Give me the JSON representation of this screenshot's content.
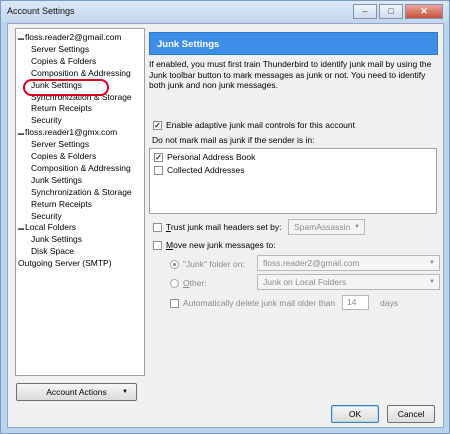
{
  "window": {
    "title": "Account Settings"
  },
  "tree": {
    "items": [
      {
        "label": "floss.reader2@gmail.com",
        "level": 0,
        "expander": "▬"
      },
      {
        "label": "Server Settings",
        "level": 1
      },
      {
        "label": "Copies & Folders",
        "level": 1
      },
      {
        "label": "Composition & Addressing",
        "level": 1
      },
      {
        "label": "Junk Settings",
        "level": 1
      },
      {
        "label": "Synchronization & Storage",
        "level": 1
      },
      {
        "label": "Return Receipts",
        "level": 1
      },
      {
        "label": "Security",
        "level": 1
      },
      {
        "label": "floss.reader1@gmx.com",
        "level": 0,
        "expander": "▬"
      },
      {
        "label": "Server Settings",
        "level": 1
      },
      {
        "label": "Copies & Folders",
        "level": 1
      },
      {
        "label": "Composition & Addressing",
        "level": 1
      },
      {
        "label": "Junk Settings",
        "level": 1
      },
      {
        "label": "Synchronization & Storage",
        "level": 1
      },
      {
        "label": "Return Receipts",
        "level": 1
      },
      {
        "label": "Security",
        "level": 1
      },
      {
        "label": "Local Folders",
        "level": 0,
        "expander": "▬"
      },
      {
        "label": "Junk Settings",
        "level": 1
      },
      {
        "label": "Disk Space",
        "level": 1
      },
      {
        "label": "Outgoing Server (SMTP)",
        "level": 0
      }
    ]
  },
  "account_actions": {
    "label": "Account Actions",
    "arrow": "▼"
  },
  "panel": {
    "header": "Junk Settings",
    "intro": "If enabled, you must first train Thunderbird to identify junk mail by using the Junk toolbar button to mark messages as junk or not. You need to identify both junk and non junk messages.",
    "enable_adaptive": {
      "label": "Enable adaptive junk mail controls for this account",
      "checked": true
    },
    "whitelist_label": "Do not mark mail as junk if the sender is in:",
    "address_books": [
      {
        "label": "Personal Address Book",
        "checked": true
      },
      {
        "label": "Collected Addresses",
        "checked": false
      }
    ],
    "trust_headers": {
      "label": "Trust junk mail headers set by:",
      "checked": false,
      "dropdown": "SpamAssassin"
    },
    "move_junk": {
      "label": "Move new junk messages to:",
      "checked": false
    },
    "junk_folder_on": {
      "label": "\"Junk\" folder on:",
      "selected": true,
      "dropdown": "floss.reader2@gmail.com"
    },
    "other": {
      "label": "Other:",
      "selected": false,
      "dropdown": "Junk on Local Folders"
    },
    "auto_delete": {
      "label": "Automatically delete junk mail older than",
      "checked": false,
      "days_value": "14",
      "days_unit": "days"
    }
  },
  "buttons": {
    "ok": "OK",
    "cancel": "Cancel"
  },
  "icons": {
    "minimize": "–",
    "maximize": "□",
    "close": "✕"
  }
}
